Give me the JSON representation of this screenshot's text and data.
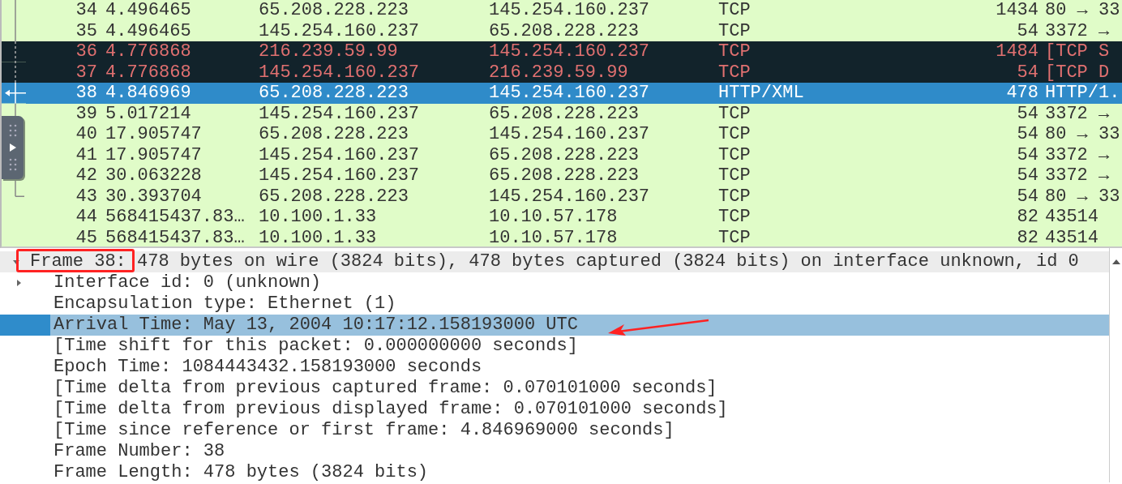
{
  "packet_list": {
    "rows": [
      {
        "no": "34",
        "time": "4.496465",
        "source": "65.208.228.223",
        "destination": "145.254.160.237",
        "protocol": "TCP",
        "length": "1434",
        "info": "80 → 33",
        "kind": "normal",
        "selected": false
      },
      {
        "no": "35",
        "time": "4.496465",
        "source": "145.254.160.237",
        "destination": "65.208.228.223",
        "protocol": "TCP",
        "length": "54",
        "info": "3372 →",
        "kind": "normal",
        "selected": false
      },
      {
        "no": "36",
        "time": "4.776868",
        "source": "216.239.59.99",
        "destination": "145.254.160.237",
        "protocol": "TCP",
        "length": "1484",
        "info": "[TCP S",
        "kind": "bad",
        "selected": false
      },
      {
        "no": "37",
        "time": "4.776868",
        "source": "145.254.160.237",
        "destination": "216.239.59.99",
        "protocol": "TCP",
        "length": "54",
        "info": "[TCP D",
        "kind": "bad",
        "selected": false
      },
      {
        "no": "38",
        "time": "4.846969",
        "source": "65.208.228.223",
        "destination": "145.254.160.237",
        "protocol": "HTTP/XML",
        "length": "478",
        "info": "HTTP/1.",
        "kind": "normal",
        "selected": true
      },
      {
        "no": "39",
        "time": "5.017214",
        "source": "145.254.160.237",
        "destination": "65.208.228.223",
        "protocol": "TCP",
        "length": "54",
        "info": "3372 →",
        "kind": "normal",
        "selected": false
      },
      {
        "no": "40",
        "time": "17.905747",
        "source": "65.208.228.223",
        "destination": "145.254.160.237",
        "protocol": "TCP",
        "length": "54",
        "info": "80 → 33",
        "kind": "normal",
        "selected": false
      },
      {
        "no": "41",
        "time": "17.905747",
        "source": "145.254.160.237",
        "destination": "65.208.228.223",
        "protocol": "TCP",
        "length": "54",
        "info": "3372 →",
        "kind": "normal",
        "selected": false
      },
      {
        "no": "42",
        "time": "30.063228",
        "source": "145.254.160.237",
        "destination": "65.208.228.223",
        "protocol": "TCP",
        "length": "54",
        "info": "3372 →",
        "kind": "normal",
        "selected": false
      },
      {
        "no": "43",
        "time": "30.393704",
        "source": "65.208.228.223",
        "destination": "145.254.160.237",
        "protocol": "TCP",
        "length": "54",
        "info": "80 → 33",
        "kind": "normal",
        "selected": false
      },
      {
        "no": "44",
        "time": "568415437.83…",
        "source": "10.100.1.33",
        "destination": "10.10.57.178",
        "protocol": "TCP",
        "length": "82",
        "info": "43514",
        "kind": "normal",
        "selected": false
      },
      {
        "no": "45",
        "time": "568415437.83…",
        "source": "10.100.1.33",
        "destination": "10.10.57.178",
        "protocol": "TCP",
        "length": "82",
        "info": "43514",
        "kind": "normal",
        "selected": false
      }
    ]
  },
  "packet_details": {
    "label": "Frame 38: 478 bytes on wire (3824 bits), 478 bytes captured (3824 bits) on interface unknown, id 0",
    "expanded": true,
    "children": [
      {
        "label": "Interface id: 0 (unknown)",
        "kind": "branch",
        "expanded": false,
        "selected": false
      },
      {
        "label": "Encapsulation type: Ethernet (1)",
        "kind": "leaf",
        "selected": false
      },
      {
        "label": "Arrival Time: May 13, 2004 10:17:12.158193000 UTC",
        "kind": "leaf",
        "selected": true
      },
      {
        "label": "[Time shift for this packet: 0.000000000 seconds]",
        "kind": "leaf",
        "selected": false
      },
      {
        "label": "Epoch Time: 1084443432.158193000 seconds",
        "kind": "leaf",
        "selected": false
      },
      {
        "label": "[Time delta from previous captured frame: 0.070101000 seconds]",
        "kind": "leaf",
        "selected": false
      },
      {
        "label": "[Time delta from previous displayed frame: 0.070101000 seconds]",
        "kind": "leaf",
        "selected": false
      },
      {
        "label": "[Time since reference or first frame: 4.846969000 seconds]",
        "kind": "leaf",
        "selected": false
      },
      {
        "label": "Frame Number: 38",
        "kind": "leaf",
        "selected": false
      },
      {
        "label": "Frame Length: 478 bytes (3824 bits)",
        "kind": "leaf",
        "selected": false
      }
    ]
  }
}
